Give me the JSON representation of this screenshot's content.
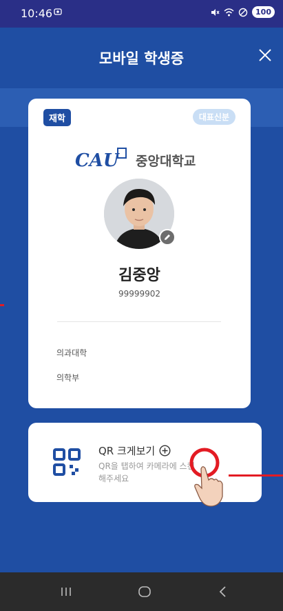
{
  "status_bar": {
    "time": "10:46",
    "battery": "100"
  },
  "header": {
    "title": "모바일 학생증"
  },
  "card": {
    "status_badge": "재학",
    "primary_badge": "대표신분",
    "logo_text": "CAU",
    "university": "중앙대학교",
    "name": "김중앙",
    "student_id": "99999902",
    "college": "의과대학",
    "department": "의학부"
  },
  "qr": {
    "title": "QR 크게보기",
    "description": "QR을 탭하여 카메라에 스캔해주세요"
  },
  "colors": {
    "primary": "#1f4ea3",
    "status_bar": "#2a2f87",
    "highlight": "#e31b23"
  }
}
